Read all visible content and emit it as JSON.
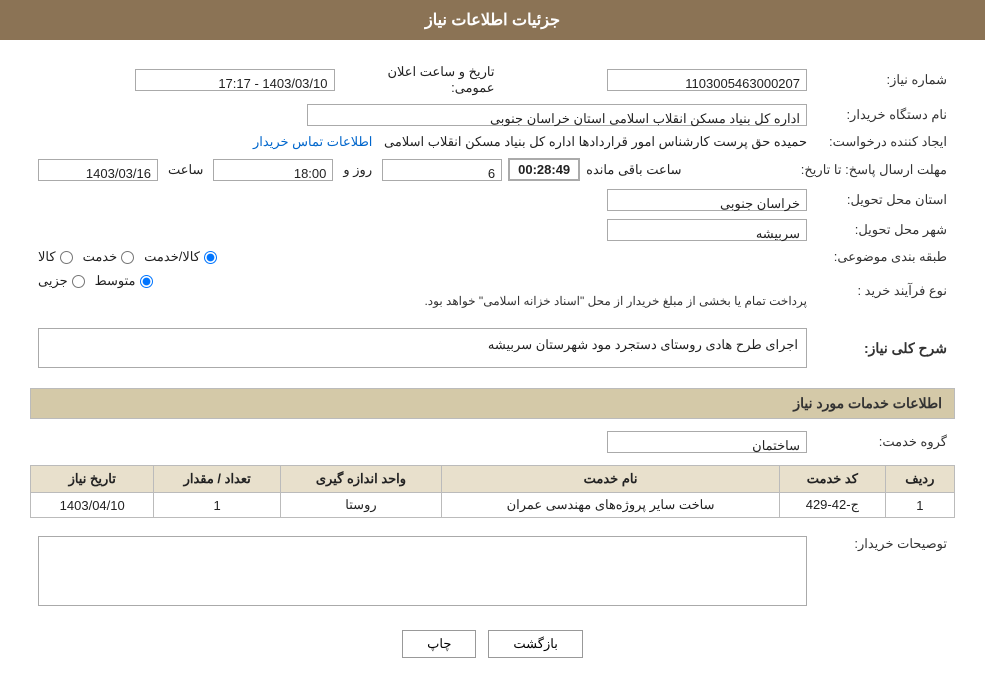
{
  "header": {
    "title": "جزئیات اطلاعات نیاز"
  },
  "labels": {
    "shomareNiaz": "شماره نیاز:",
    "namDastgah": "نام دستگاه خریدار:",
    "ijadKonande": "ایجاد کننده درخواست:",
    "mohlatErsalPasokh": "مهلت ارسال پاسخ: تا تاریخ:",
    "ostanMahalTahvil": "استان محل تحویل:",
    "shahrMahalTahvil": "شهر محل تحویل:",
    "tabaqebandiMovzui": "طبقه بندی موضوعی:",
    "noeFarayandKharid": "نوع فرآیند خرید :",
    "sharhKolliNiaz": "شرح کلی نیاز:",
    "ettelaatKhadamat": "اطلاعات خدمات مورد نیاز",
    "grohKhadamat": "گروه خدمت:",
    "touseehKharidar": "توصیحات خریدار:"
  },
  "values": {
    "shomareNiaz": "1103005463000207",
    "tarikhVaSaat": "تاریخ و ساعت اعلان عمومی:",
    "tarikhValue": "1403/03/10 - 17:17",
    "namDastgahValue": "اداره کل بنیاد مسکن انقلاب اسلامی استان خراسان جنوبی",
    "ijadKonandehValue": "حمیده حق پرست کارشناس امور قراردادها اداره کل بنیاد مسکن انقلاب اسلامی",
    "ettelaatTamas": "اطلاعات تماس خریدار",
    "mohlatTarikh": "1403/03/16",
    "mohlatSaat": "18:00",
    "mohlatRoz": "6",
    "countdown": "00:28:49",
    "saatBaghiMande": "ساعت باقی مانده",
    "ostanValue": "خراسان جنوبی",
    "shahrValue": "سربیشه",
    "tabaqehKala": "کالا",
    "tabaqehKhadamat": "خدمت",
    "tabaqehKalaKhadamat": "کالا/خدمت",
    "noeFarayand1": "جزیی",
    "noeFarayand2": "متوسط",
    "noteText": "پرداخت تمام یا بخشی از مبلغ خریدار از محل \"اسناد خزانه اسلامی\" خواهد بود.",
    "sharhNiazValue": "اجرای طرح هادی روستای دستجرد مود شهرستان سربیشه",
    "grohKhadamatValue": "ساختمان",
    "serviceTableHeaders": {
      "radif": "ردیف",
      "codKhadamat": "کد خدمت",
      "namKhadamat": "نام خدمت",
      "vahedAndazehgiri": "واحد اندازه گیری",
      "tedadMeqdar": "تعداد / مقدار",
      "tarikhNiaz": "تاریخ نیاز"
    },
    "serviceRows": [
      {
        "radif": "1",
        "codKhadamat": "ج-42-429",
        "namKhadamat": "ساخت سایر پروژه‌های مهندسی عمران",
        "vahedAndazehgiri": "روستا",
        "tedadMeqdar": "1",
        "tarikhNiaz": "1403/04/10"
      }
    ],
    "buttons": {
      "chap": "چاپ",
      "bazgasht": "بازگشت"
    }
  }
}
